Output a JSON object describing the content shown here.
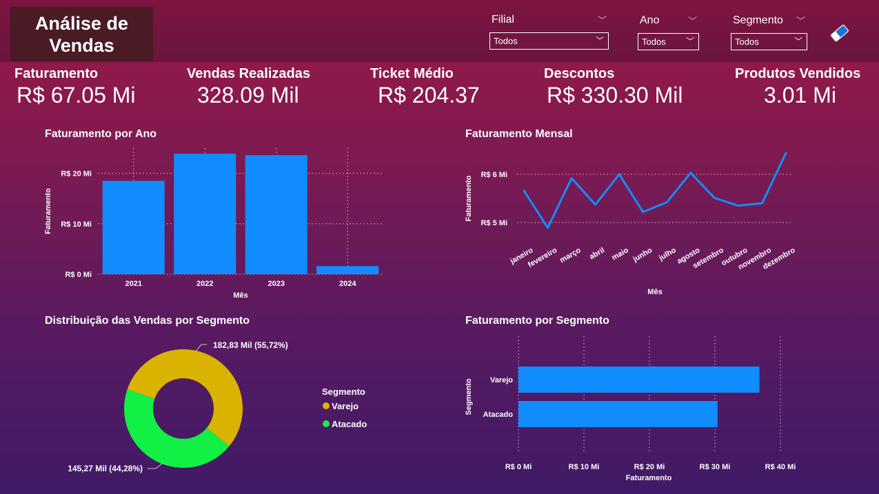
{
  "header": {
    "title": "Análise de\nVendas",
    "filters": [
      {
        "label": "Filial",
        "value": "Todos"
      },
      {
        "label": "Ano",
        "value": "Todos"
      },
      {
        "label": "Segmento",
        "value": "Todos"
      }
    ],
    "clear_icon": "eraser-icon"
  },
  "kpis": [
    {
      "label": "Faturamento",
      "value": "R$ 67.05 Mi"
    },
    {
      "label": "Vendas Realizadas",
      "value": "328.09 Mil"
    },
    {
      "label": "Ticket Médio",
      "value": "R$ 204.37"
    },
    {
      "label": "Descontos",
      "value": "R$ 330.30 Mil"
    },
    {
      "label": "Produtos Vendidos",
      "value": "3.01 Mi"
    }
  ],
  "colors": {
    "bar": "#118dff",
    "varejo": "#d9b300",
    "atacado": "#12ef45"
  },
  "chart_data": [
    {
      "id": "faturamento_ano",
      "type": "bar",
      "title": "Faturamento por Ano",
      "xlabel": "Mês",
      "ylabel": "Faturamento",
      "categories": [
        "2021",
        "2022",
        "2023",
        "2024"
      ],
      "values": [
        18.5,
        23.9,
        23.6,
        1.6
      ],
      "unit": "Mi",
      "yticks": [
        "R$ 0 Mi",
        "R$ 10 Mi",
        "R$ 20 Mi"
      ],
      "ylim": [
        0,
        25
      ],
      "grid": true
    },
    {
      "id": "faturamento_mensal",
      "type": "line",
      "title": "Faturamento Mensal",
      "xlabel": "Mês",
      "ylabel": "Faturamento",
      "categories": [
        "janeiro",
        "fevereiro",
        "março",
        "abril",
        "maio",
        "junho",
        "julho",
        "agosto",
        "setembro",
        "outubro",
        "novembro",
        "dezembro"
      ],
      "values": [
        5.66,
        4.89,
        5.92,
        5.37,
        6.0,
        5.22,
        5.42,
        6.03,
        5.51,
        5.35,
        5.4,
        6.44
      ],
      "unit": "Mi",
      "yticks": [
        "R$ 5 Mi",
        "R$ 6 Mi"
      ],
      "grid": true
    },
    {
      "id": "distribuicao_segmento",
      "type": "pie",
      "title": "Distribuição das Vendas por Segmento",
      "legend_title": "Segmento",
      "categories": [
        "Varejo",
        "Atacado"
      ],
      "values": [
        182.83,
        145.27
      ],
      "percents": [
        55.72,
        44.28
      ],
      "labels": [
        "182,83 Mil (55,72%)",
        "145,27 Mil (44,28%)"
      ]
    },
    {
      "id": "faturamento_segmento",
      "type": "bar",
      "orientation": "horizontal",
      "title": "Faturamento por Segmento",
      "xlabel": "Faturamento",
      "ylabel": "Segmento",
      "categories": [
        "Varejo",
        "Atacado"
      ],
      "values": [
        36.8,
        30.4
      ],
      "unit": "Mi",
      "xticks": [
        "R$ 0 Mi",
        "R$ 10 Mi",
        "R$ 20 Mi",
        "R$ 30 Mi",
        "R$ 40 Mi"
      ],
      "xlim": [
        0,
        40
      ],
      "grid": true
    }
  ]
}
